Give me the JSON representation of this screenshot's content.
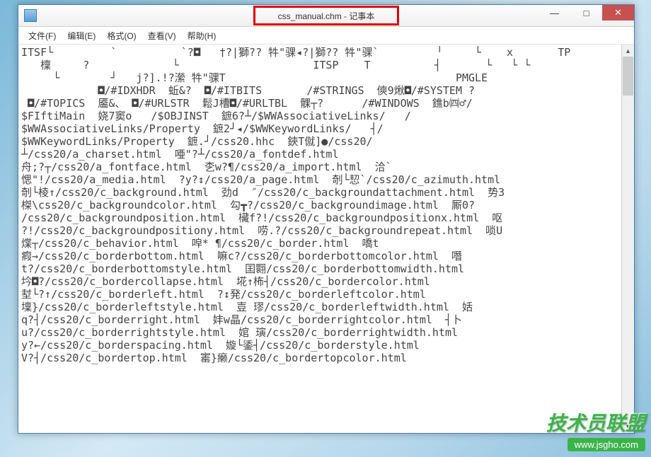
{
  "window": {
    "title": "css_manual.chm - 记事本",
    "app_icon": "notepad-icon"
  },
  "controls": {
    "minimize": "—",
    "maximize": "□",
    "close": "✕"
  },
  "menu": {
    "file": "文件(F)",
    "edit": "编辑(E)",
    "format": "格式(O)",
    "view": "查看(V)",
    "help": "帮助(H)"
  },
  "content": {
    "text": "ITSF└         `          `?◘   †?|獅?? 牪\"骒◂?|獅?? 牪\"骒`         ╵     └    x       TP\n   檁     ?             └                     ITSP    T          ┤       └   └ └\n     └        ┘   j?].!?瀠 牪\"骒T                                    PMGLE\n            ◘/#IDXHDR  蚯&?  ◘/#ITBITS       /#STRINGS  傸9煍◘/#SYSTEM ?\n ◘/#TOPICS  靥&、 ◘/#URLSTR  鬆J槽◘/#URLTBL  髁┬?      /#WINDOWS  鐎b㈣♂/\n$FIftiMain  娆7窦o   /$OBJINST  鏣6?┴/$WWAssociativeLinks/   /\n$WWAssociativeLinks/Property  鏣2┘◂/$WWKeywordLinks/   ┤/\n$WWKeywordLinks/Property  鏣.┘/css20.hhc  鋏T僦]●/css20/\n┴/css20/a_charset.html  唖\"?┴/css20/a_fontdef.html\n舟;?┬/css20/a_fontface.html  朰w?¶/css20/a_import.html  洽`\n愢\"!/css20/a_media.html  ?y?↕/css20/a_page.html  剞└恝`/css20/c_azimuth.html\n剞└棱↑/css20/c_background.html  劲d  ″/css20/c_backgroundattachment.html  势3\n榤\\css20/c_backgroundcolor.html  勾┳?/css20/c_backgroundimage.html  厮0?\n/css20/c_backgroundposition.html  欌f?!/css20/c_backgroundpositionx.html  呕\n?!/css20/c_backgroundpositiony.html  唠.?/css20/c_backgroundrepeat.html  唢U\n煠┬/css20/c_behavior.html  唕* ¶/css20/c_border.html  嘺t\n瘕→/css20/c_borderbottom.html  嘛c?/css20/c_borderbottomcolor.html  噆\nt?/css20/c_borderbottomstyle.html  囯翾/css20/c_borderbottomwidth.html\n坅◘?/css20/c_bordercollapse.html  埖↑柨┤/css20/c_bordercolor.html\n堼└?↑/css20/c_borderleft.html  ?↕発/css20/c_borderleftcolor.html\n壈}/css20/c_borderleftstyle.html  壴 璆/css20/c_borderleftwidth.html  姡\nq?┤/css20/c_borderright.html  妦w晶/css20/c_borderrightcolor.html  ┤卜\nu?/css20/c_borderrightstyle.html  婠 璌/css20/c_borderrightwidth.html\ny?←/css20/c_borderspacing.html  嫙└鋈┤/css20/c_borderstyle.html\nV?┤/css20/c_bordertop.html  寚}癞/css20/c_bordertopcolor.html"
  },
  "watermark": {
    "name": "技术员联盟",
    "url": "www.jsgho.com"
  }
}
